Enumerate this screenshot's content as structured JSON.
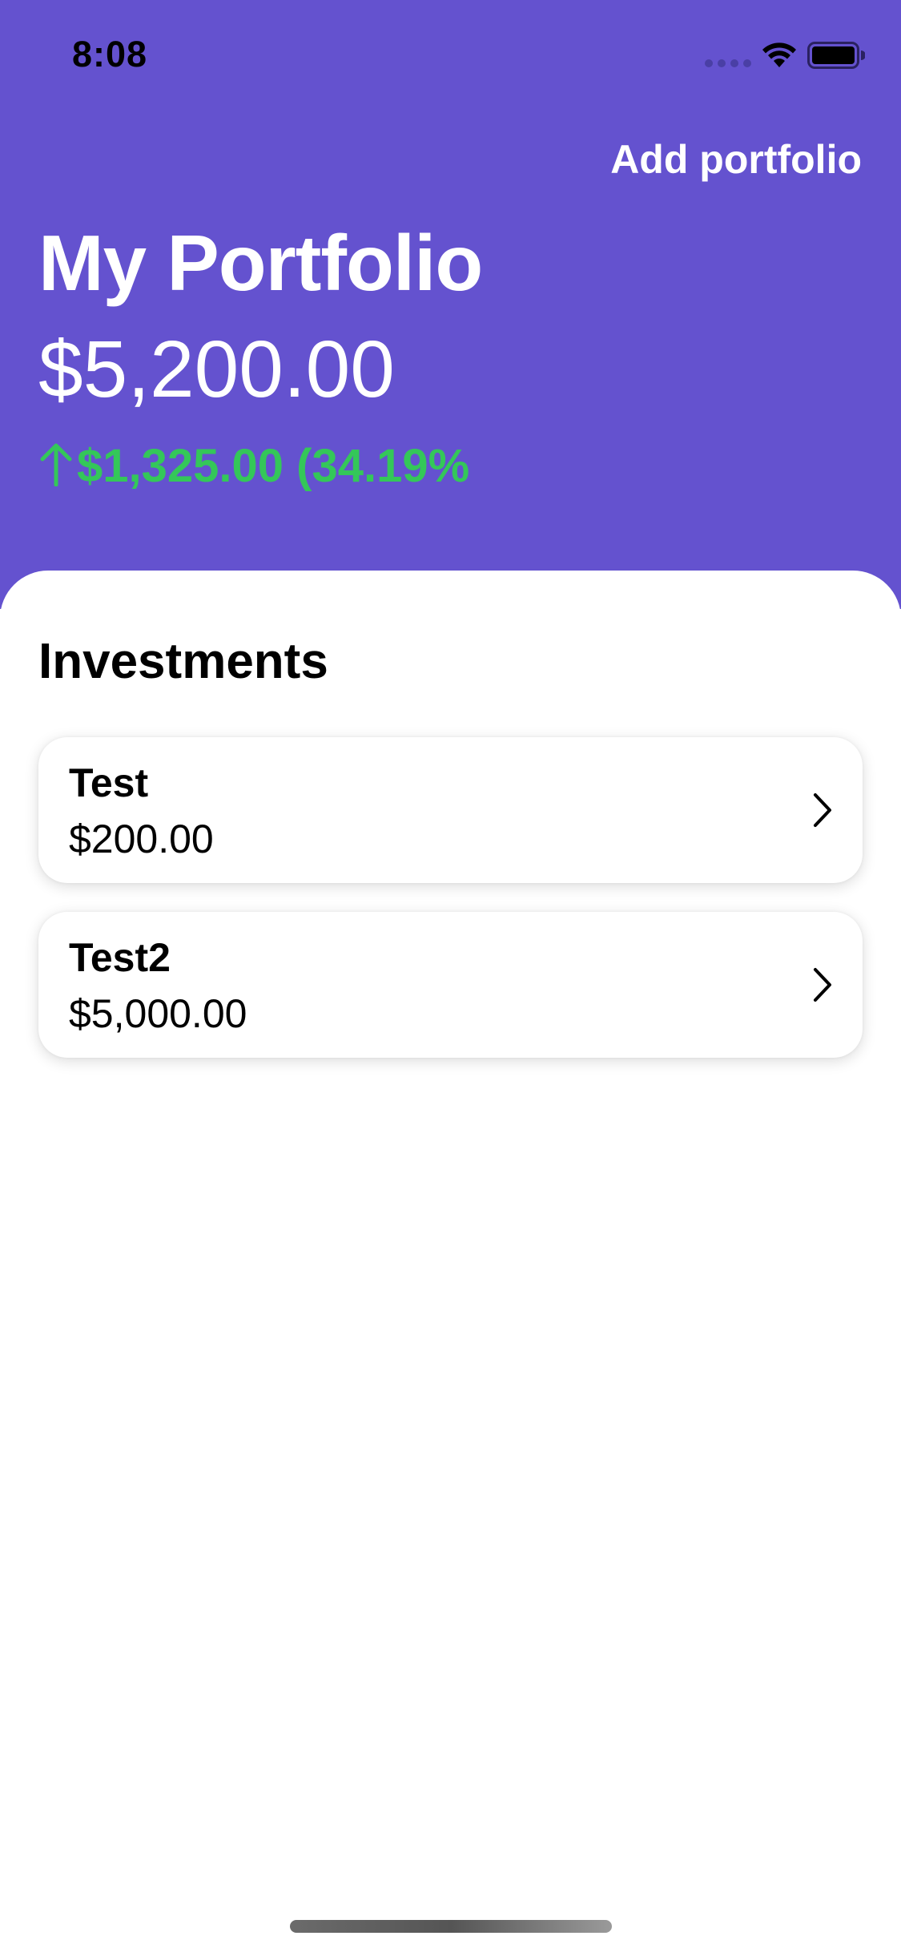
{
  "status_bar": {
    "time": "8:08"
  },
  "header": {
    "add_portfolio_label": "Add portfolio",
    "title": "My Portfolio",
    "total_value": "$5,200.00",
    "change_text": "$1,325.00 (34.19%",
    "change_icon": "arrow-up-icon"
  },
  "investments": {
    "title": "Investments",
    "items": [
      {
        "name": "Test",
        "amount": "$200.00"
      },
      {
        "name": "Test2",
        "amount": "$5,000.00"
      }
    ]
  },
  "colors": {
    "header_background": "#6452cf",
    "positive_change": "#34c759",
    "card_background": "#ffffff",
    "text_primary": "#000000",
    "text_on_header": "#ffffff"
  }
}
